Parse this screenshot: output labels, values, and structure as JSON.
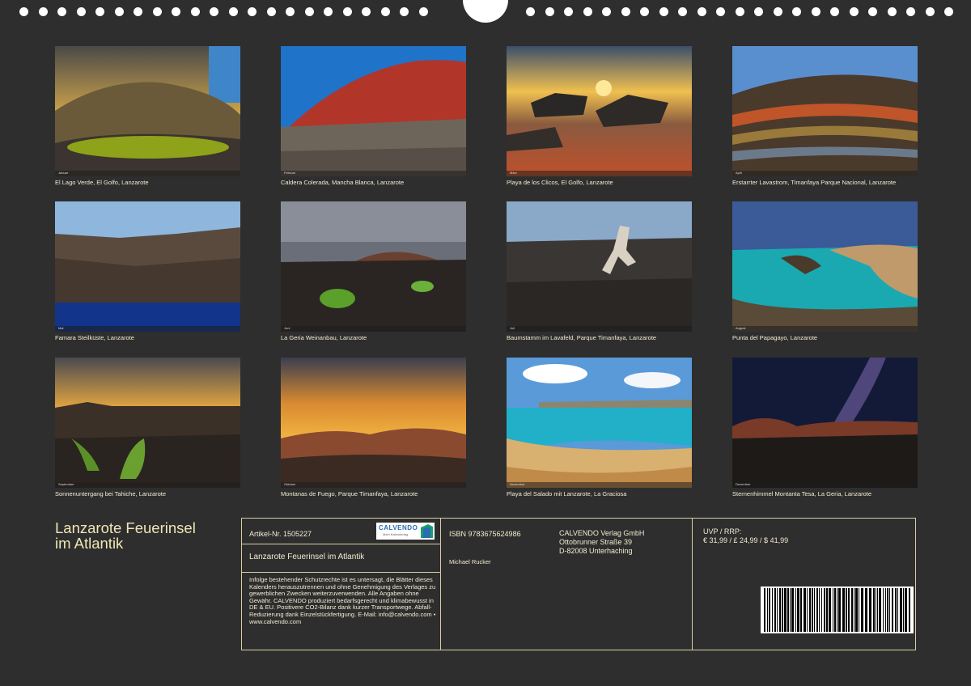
{
  "photos": [
    {
      "caption": "El Lago Verde, El Golfo, Lanzarote",
      "month": "Januar"
    },
    {
      "caption": "Caldera Colerada, Mancha Blanca, Lanzarote",
      "month": "Februar"
    },
    {
      "caption": "Playa de los Clicos, El Golfo, Lanzarote",
      "month": "März"
    },
    {
      "caption": "Erstarrter Lavastrom, Timanfaya Parque Nacional, Lanzarote",
      "month": "April"
    },
    {
      "caption": "Famara Steilküste, Lanzarote",
      "month": "Mai"
    },
    {
      "caption": "La Geria Weinanbau, Lanzarote",
      "month": "Juni"
    },
    {
      "caption": "Baumstamm im Lavafeld, Parque Timanfaya, Lanzarote",
      "month": "Juli"
    },
    {
      "caption": "Punta del Papagayo, Lanzarote",
      "month": "August"
    },
    {
      "caption": "Sonnenuntergang bei Tahiche, Lanzarote",
      "month": "September"
    },
    {
      "caption": "Montanas de Fuego, Parque Timanfaya, Lanzarote",
      "month": "Oktober"
    },
    {
      "caption": "Playa del Salado mit Lanzarote, La Graciosa",
      "month": "November"
    },
    {
      "caption": "Sternenhimmel Montanta Tesa, La Geria, Lanzarote",
      "month": "Dezember"
    }
  ],
  "title_line1": "Lanzarote Feuerinsel",
  "title_line2": "im Atlantik",
  "info": {
    "article": "Artikel-Nr. 1505227",
    "logo_brand": "CALVENDO",
    "logo_sub": "Mein Kalendertag",
    "product_title": "Lanzarote Feuerinsel im Atlantik",
    "legal": "Infolge bestehender Schutzrechte ist es untersagt, die Blätter dieses Kalenders herauszutrennen und ohne Genehmigung des Verlages zu gewerblichen Zwecken weiterzuverwenden. Alle Angaben ohne Gewähr. CALVENDO produziert bedarfsgerecht und klimabewusst in DE & EU. Positivere CO2-Bilanz dank kurzer Transportwege. Abfall-Reduzierung dank Einzelstückfertigung. E-Mail: info@calvendo.com • www.calvendo.com",
    "isbn": "ISBN 9783675624986",
    "author": "Michael Rucker",
    "publisher_name": "CALVENDO Verlag GmbH",
    "publisher_street": "Ottobrunner Straße 39",
    "publisher_city": "D-82008 Unterhaching",
    "price_label": "UVP / RRP:",
    "price_values": "€ 31,99 / £ 24,99 / $ 41,99"
  }
}
